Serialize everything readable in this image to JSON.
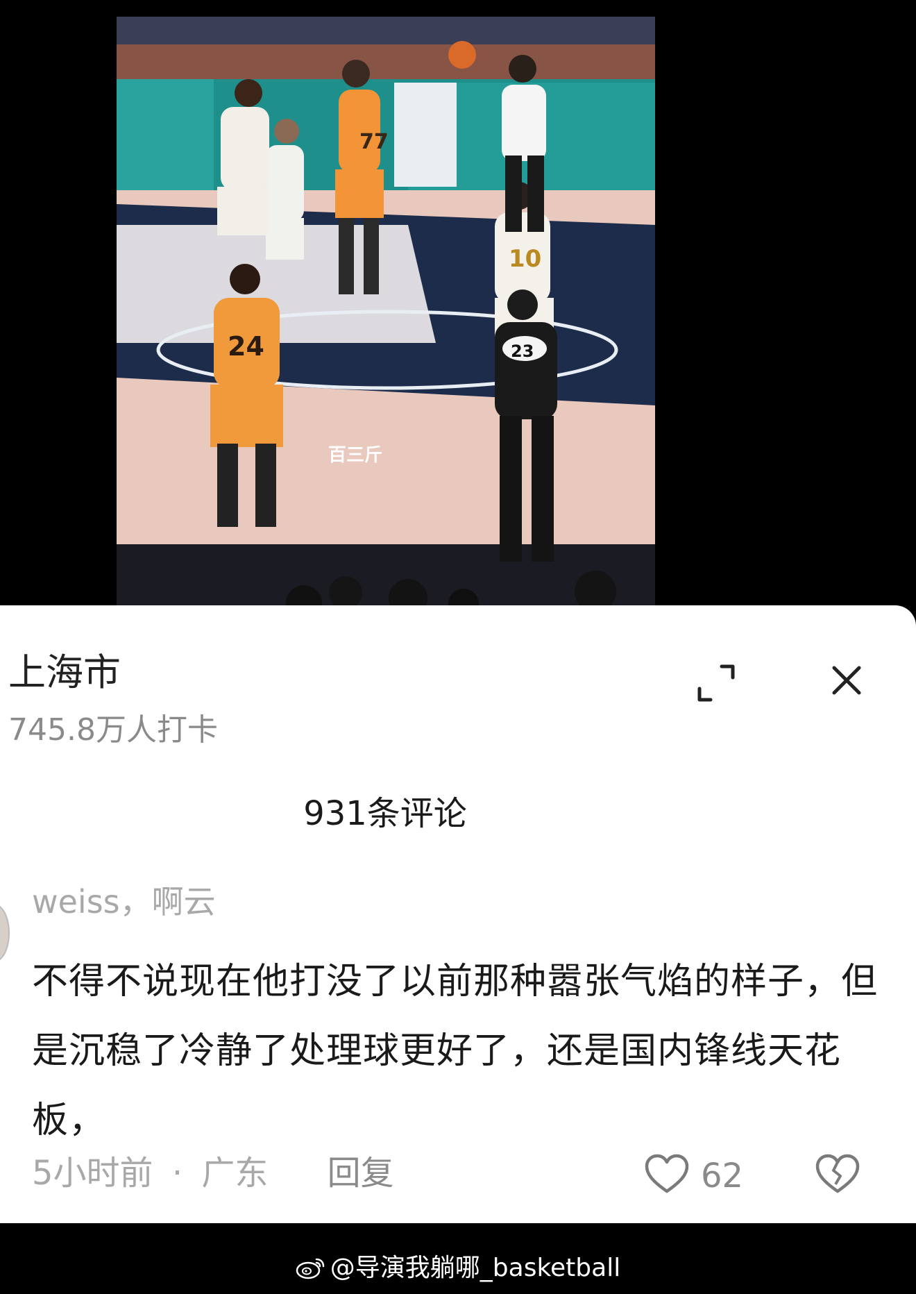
{
  "location": {
    "title": "上海市",
    "checkins": "745.8万人打卡"
  },
  "comments_header": {
    "count_label": "931条评论"
  },
  "comment": {
    "username": "weiss，啊云",
    "text": "不得不说现在他打没了以前那种嚣张气焰的样子，但是沉稳了冷静了处理球更好了，还是国内锋线天花板，",
    "time": "5小时前",
    "separator": "·",
    "region": "广东",
    "reply_label": "回复",
    "likes": "62"
  },
  "photo": {
    "logo_text": "百三斤",
    "jerseys": [
      "77",
      "24",
      "10",
      "23",
      "23"
    ]
  },
  "icons": {
    "expand": "expand-icon",
    "close": "close-icon",
    "like": "heart-icon",
    "dislike": "broken-heart-icon",
    "weibo": "weibo-icon"
  },
  "watermark": {
    "text": "@导演我躺哪_basketball"
  },
  "colors": {
    "sheet_bg": "#ffffff",
    "page_bg": "#000000",
    "muted_text": "#a8a8a8"
  }
}
